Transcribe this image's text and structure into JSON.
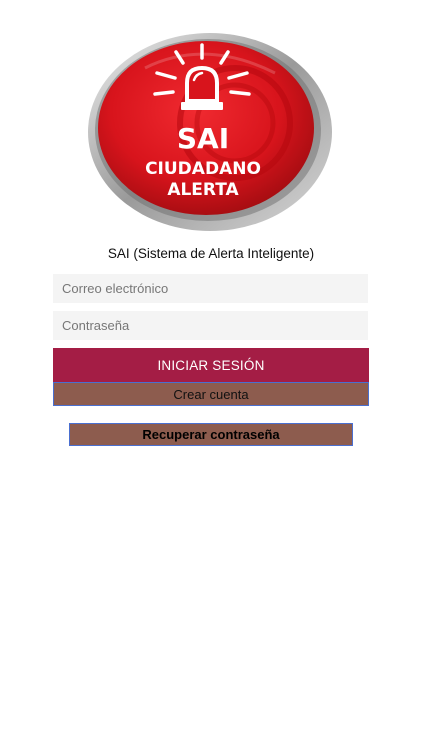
{
  "logo": {
    "line1": "SAI",
    "line2": "CIUDADANO",
    "line3": "ALERTA",
    "icon": "siren-icon",
    "colors": {
      "red": "#d8141c",
      "dark_red": "#a80d12",
      "silver": "#c9c9c9"
    }
  },
  "subtitle": "SAI (Sistema de Alerta Inteligente)",
  "form": {
    "email_placeholder": "Correo electrónico",
    "email_value": "",
    "password_placeholder": "Contraseña",
    "password_value": ""
  },
  "buttons": {
    "login": "INICIAR SESIÓN",
    "create_account": "Crear cuenta",
    "recover_password": "Recuperar contraseña"
  },
  "colors": {
    "login_bg": "#a41d45",
    "secondary_bg": "#8d5c4e",
    "secondary_border": "#4a6fd0"
  }
}
